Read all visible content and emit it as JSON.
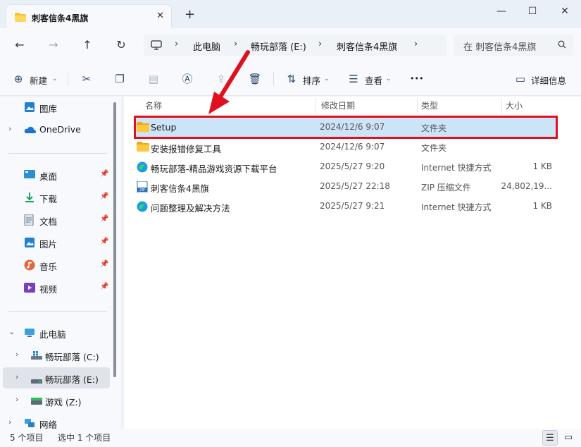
{
  "window": {
    "tab_title": "刺客信条4黑旗",
    "close_tab": "✕",
    "new_tab": "+",
    "minimize": "—",
    "maximize": "☐",
    "close": "✕"
  },
  "address_bar": {
    "breadcrumbs": [
      "此电脑",
      "畅玩部落 (E:)",
      "刺客信条4黑旗"
    ],
    "separator": "›"
  },
  "search": {
    "placeholder": "在 刺客信条4黑旗"
  },
  "toolbar": {
    "new_label": "新建",
    "sort_label": "排序",
    "view_label": "查看",
    "more_label": "•••",
    "details_label": "详细信息"
  },
  "sidebar": {
    "gallery": "图库",
    "onedrive": "OneDrive",
    "quick_access": [
      {
        "label": "桌面",
        "icon": "desktop-icon"
      },
      {
        "label": "下载",
        "icon": "download-icon"
      },
      {
        "label": "文档",
        "icon": "document-icon"
      },
      {
        "label": "图片",
        "icon": "pictures-icon"
      },
      {
        "label": "音乐",
        "icon": "music-icon"
      },
      {
        "label": "视频",
        "icon": "video-icon"
      }
    ],
    "this_pc": "此电脑",
    "drives": [
      {
        "label": "畅玩部落 (C:)",
        "icon": "windows-drive-icon"
      },
      {
        "label": "畅玩部落 (E:)",
        "icon": "drive-icon",
        "selected": true
      },
      {
        "label": "游戏 (Z:)",
        "icon": "drive-icon"
      }
    ],
    "network": "网络"
  },
  "columns": {
    "name": "名称",
    "modified": "修改日期",
    "type": "类型",
    "size": "大小"
  },
  "files": [
    {
      "name": "Setup",
      "modified": "2024/12/6 9:07",
      "type": "文件夹",
      "size": "",
      "icon": "folder-icon",
      "selected": true
    },
    {
      "name": "安装报错修复工具",
      "modified": "2024/12/6 9:07",
      "type": "文件夹",
      "size": "",
      "icon": "folder-icon"
    },
    {
      "name": "畅玩部落-精品游戏资源下载平台",
      "modified": "2025/5/27 9:20",
      "type": "Internet 快捷方式",
      "size": "1 KB",
      "icon": "edge-shortcut-icon"
    },
    {
      "name": "刺客信条4黑旗",
      "modified": "2025/5/27 22:18",
      "type": "ZIP 压缩文件",
      "size": "24,802,19...",
      "icon": "zip-icon"
    },
    {
      "name": "问题整理及解决方法",
      "modified": "2025/5/27 9:21",
      "type": "Internet 快捷方式",
      "size": "1 KB",
      "icon": "edge-shortcut-icon"
    }
  ],
  "status": {
    "item_count": "5 个项目",
    "selected": "选中 1 个项目"
  },
  "colors": {
    "accent": "#0067c0",
    "selection": "#cce4f7",
    "highlight": "#e0101c",
    "folder": "#f4c430"
  }
}
